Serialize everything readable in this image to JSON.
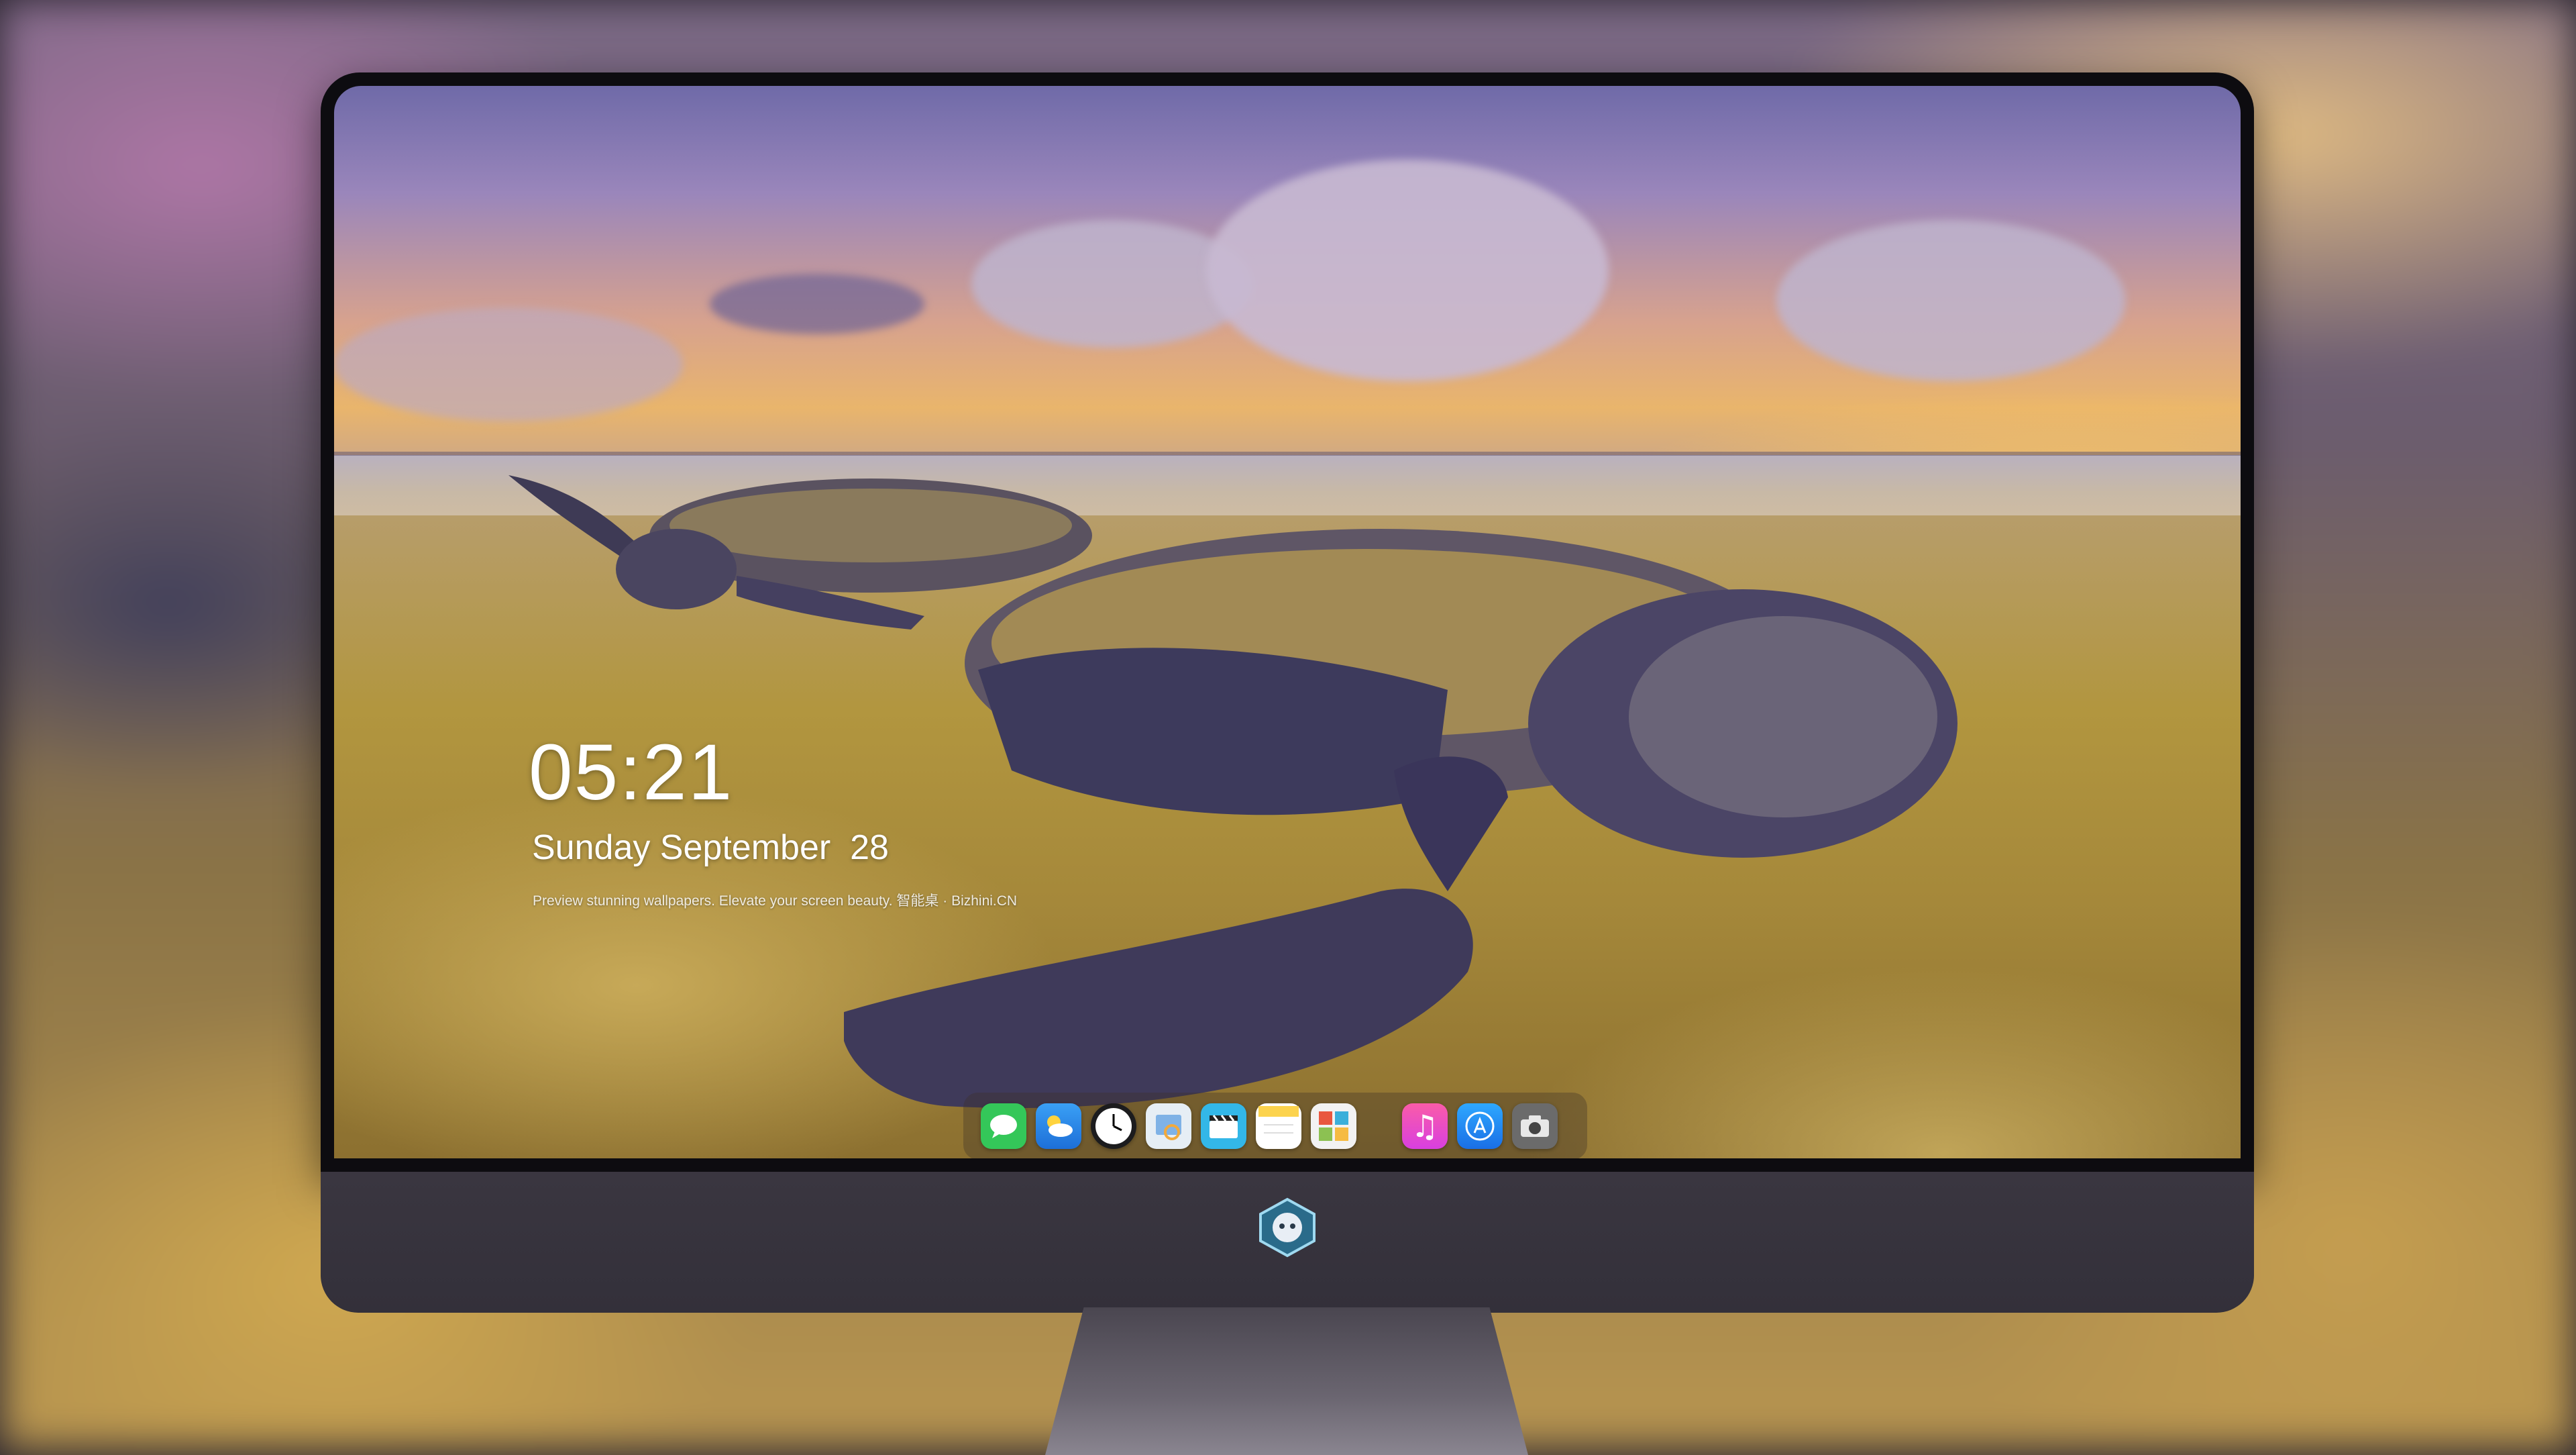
{
  "lock_screen": {
    "time": "05:21",
    "date": "Sunday September  28",
    "tagline": "Preview stunning wallpapers. Elevate your screen beauty. 智能桌 · Bizhini.CN"
  },
  "dock": {
    "apps": [
      {
        "name": "Messages",
        "icon": "messages-icon",
        "color": "#34c759"
      },
      {
        "name": "Weather",
        "icon": "weather-icon",
        "color": "#2f8cf0"
      },
      {
        "name": "Clock",
        "icon": "clock-icon",
        "color": "#1c1c1e"
      },
      {
        "name": "Preview",
        "icon": "preview-icon",
        "color": "#e6eef5"
      },
      {
        "name": "Clips",
        "icon": "clips-icon",
        "color": "#33b7e8"
      },
      {
        "name": "Notes",
        "icon": "notes-icon",
        "color": "#fcd34d"
      },
      {
        "name": "Photo Booth",
        "icon": "photo-booth-icon",
        "color": "#f2f2f2"
      },
      {
        "name": "Music",
        "icon": "music-icon",
        "color": "#f84aa7"
      },
      {
        "name": "App Store",
        "icon": "app-store-icon",
        "color": "#1d8cf7"
      },
      {
        "name": "Camera",
        "icon": "camera-icon",
        "color": "#6b6b6b"
      }
    ]
  },
  "colors": {
    "bezel": "#0d0c10",
    "chin": "#35313b",
    "text": "#ffffff"
  }
}
